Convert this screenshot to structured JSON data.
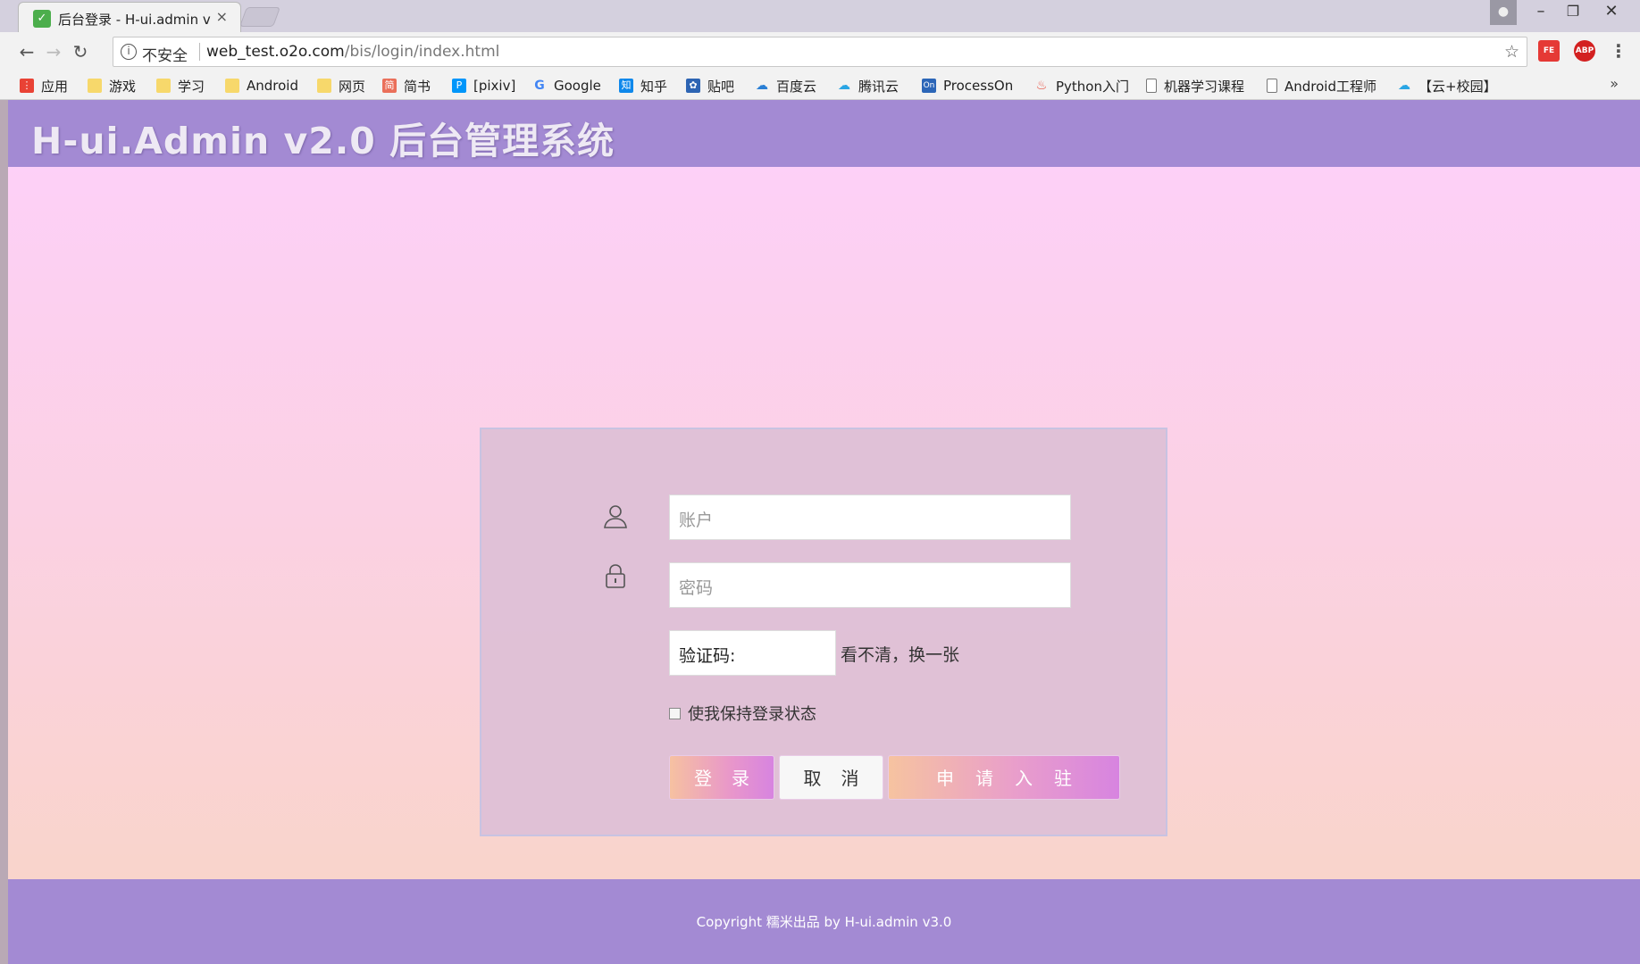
{
  "browser": {
    "tab_title": "后台登录 - H-ui.admin v",
    "tab_close": "×",
    "favicon": "leaf-icon",
    "insecure_label": "不安全",
    "url_host": "web_test.o2o.com",
    "url_path": "/bis/login/index.html",
    "bookmarks": [
      {
        "label": "应用",
        "icon": "apps-icon",
        "color": "#e94235"
      },
      {
        "label": "游戏",
        "icon": "folder-icon",
        "color": "#f7d86b"
      },
      {
        "label": "学习",
        "icon": "folder-icon",
        "color": "#f7d86b"
      },
      {
        "label": "Android",
        "icon": "folder-icon",
        "color": "#f7d86b"
      },
      {
        "label": "网页",
        "icon": "folder-icon",
        "color": "#f7d86b"
      },
      {
        "label": "简书",
        "icon": "jianshu-icon",
        "color": "#ea6f5a"
      },
      {
        "label": "[pixiv]",
        "icon": "pixiv-icon",
        "color": "#0096fa"
      },
      {
        "label": "Google",
        "icon": "google-icon",
        "color": "#4285f4"
      },
      {
        "label": "知乎",
        "icon": "zhihu-icon",
        "color": "#0f88eb"
      },
      {
        "label": "贴吧",
        "icon": "tieba-icon",
        "color": "#2d64b3"
      },
      {
        "label": "百度云",
        "icon": "baiduyun-icon",
        "color": "#2a7fd5"
      },
      {
        "label": "腾讯云",
        "icon": "cloud-icon",
        "color": "#2aa5e4"
      },
      {
        "label": "ProcessOn",
        "icon": "processon-icon",
        "color": "#2c66b8"
      },
      {
        "label": "Python入门",
        "icon": "flame-icon",
        "color": "#e74c3c"
      },
      {
        "label": "机器学习课程",
        "icon": "page-icon",
        "color": "#ffffff"
      },
      {
        "label": "Android工程师",
        "icon": "page-icon",
        "color": "#ffffff"
      },
      {
        "label": "【云+校园】",
        "icon": "cloud-icon",
        "color": "#2aa5e4"
      }
    ],
    "more": "»"
  },
  "header": {
    "title": "H-ui.Admin v2.0 后台管理系统"
  },
  "login": {
    "account_placeholder": "账户",
    "password_placeholder": "密码",
    "captcha_label": "验证码:",
    "refresh_text": "看不清，换一张",
    "remember_label": "使我保持登录状态",
    "login_button": "登录",
    "cancel_button": "取消",
    "apply_button": "申请入驻"
  },
  "footer": {
    "copyright": "Copyright 糯米出品 by H-ui.admin v3.0"
  },
  "colors": {
    "header_bg": "#a38ad3",
    "gradient_top": "#fdd0f7",
    "gradient_bottom": "#f9d4cb"
  }
}
